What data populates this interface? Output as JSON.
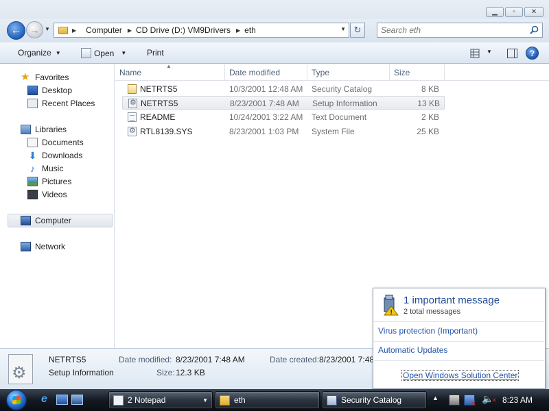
{
  "address": {
    "crumbs": [
      "Computer",
      "CD Drive (D:) VM9Drivers",
      "eth"
    ]
  },
  "search": {
    "placeholder": "Search eth"
  },
  "toolbar": {
    "organize_label": "Organize",
    "open_label": "Open",
    "print_label": "Print"
  },
  "navpane": {
    "favorites": "Favorites",
    "desktop": "Desktop",
    "recent_places": "Recent Places",
    "libraries": "Libraries",
    "documents": "Documents",
    "downloads": "Downloads",
    "music": "Music",
    "pictures": "Pictures",
    "videos": "Videos",
    "computer": "Computer",
    "network": "Network"
  },
  "columns": {
    "name": "Name",
    "date_modified": "Date modified",
    "type": "Type",
    "size": "Size"
  },
  "files": [
    {
      "name": "NETRTS5",
      "date": "10/3/2001 12:48 AM",
      "type": "Security Catalog",
      "size": "8 KB",
      "icon": "catalog-icon"
    },
    {
      "name": "NETRTS5",
      "date": "8/23/2001 7:48 AM",
      "type": "Setup Information",
      "size": "13 KB",
      "icon": "setup-info-icon"
    },
    {
      "name": "README",
      "date": "10/24/2001 3:22 AM",
      "type": "Text Document",
      "size": "2 KB",
      "icon": "text-document-icon"
    },
    {
      "name": "RTL8139.SYS",
      "date": "8/23/2001 1:03 PM",
      "type": "System File",
      "size": "25 KB",
      "icon": "system-file-icon"
    }
  ],
  "details": {
    "name": "NETRTS5",
    "type": "Setup Information",
    "date_modified_label": "Date modified:",
    "date_modified": "8/23/2001 7:48 AM",
    "size_label": "Size:",
    "size": "12.3 KB",
    "date_created_label": "Date created:",
    "date_created": "8/23/2001 7:48"
  },
  "balloon": {
    "title": "1 important message",
    "subtitle": "2 total messages",
    "link1": "Virus protection (Important)",
    "link2": "Automatic Updates",
    "center_link": "Open Windows Solution Center"
  },
  "taskbar": {
    "notepad": "2 Notepad",
    "explorer": "eth",
    "security": "Security Catalog",
    "clock": "8:23 AM"
  },
  "colors": {
    "link": "#2354a8",
    "balloon_title": "#1f4a96",
    "secondary_text": "#6d6d6d",
    "header_text": "#4c607a"
  }
}
